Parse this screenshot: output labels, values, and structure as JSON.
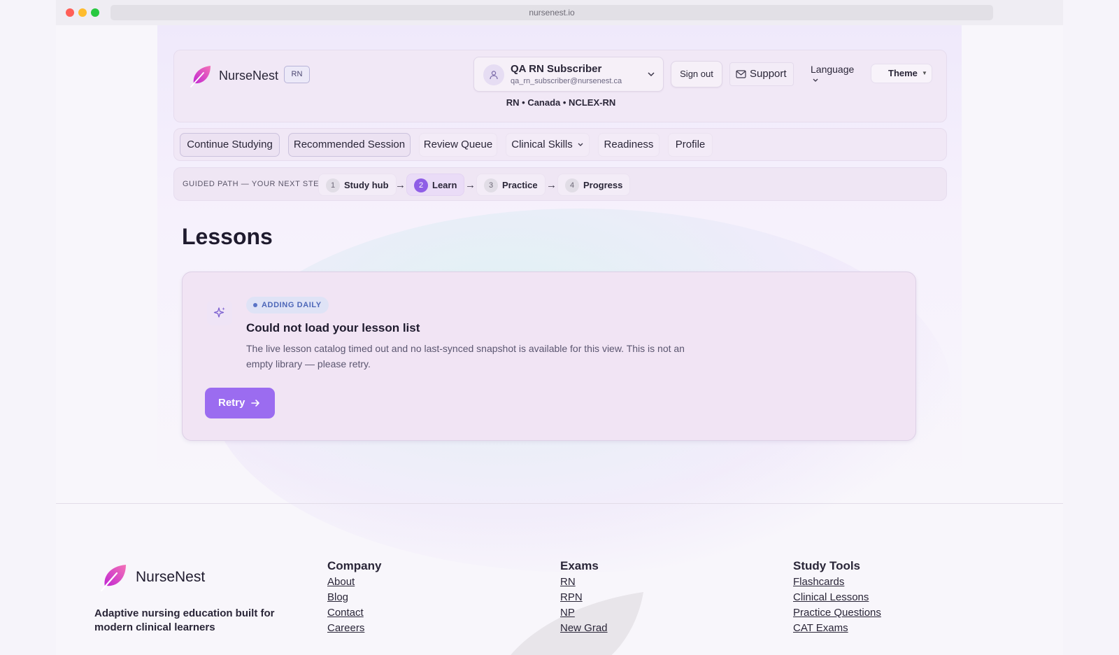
{
  "browser": {
    "url": "nursenest.io"
  },
  "header": {
    "brand": "NurseNest",
    "tier_badge": "RN",
    "user_name": "QA RN Subscriber",
    "user_email": "qa_rn_subscriber@nursenest.ca",
    "sign_out": "Sign out",
    "support": "Support",
    "language": "Language",
    "theme": "Theme",
    "context": "RN • Canada • NCLEX-RN"
  },
  "nav": {
    "items": [
      {
        "label": "Continue Studying"
      },
      {
        "label": "Recommended Session"
      },
      {
        "label": "Review Queue"
      },
      {
        "label": "Clinical Skills"
      },
      {
        "label": "Readiness"
      },
      {
        "label": "Profile"
      }
    ]
  },
  "guided_path": {
    "label": "GUIDED PATH — YOUR NEXT STEP",
    "arrow": "→",
    "steps": [
      {
        "num": "1",
        "label": "Study hub"
      },
      {
        "num": "2",
        "label": "Learn",
        "active": true
      },
      {
        "num": "3",
        "label": "Practice"
      },
      {
        "num": "4",
        "label": "Progress"
      }
    ]
  },
  "lessons": {
    "title": "Lessons",
    "badge": "ADDING DAILY",
    "error_title": "Could not load your lesson list",
    "error_body": "The live lesson catalog timed out and no last-synced snapshot is available for this view. This is not an empty library — please retry.",
    "retry": "Retry"
  },
  "footer": {
    "brand": "NurseNest",
    "tagline": "Adaptive nursing education built for modern clinical learners",
    "columns": [
      {
        "heading": "Company",
        "links": [
          "About",
          "Blog",
          "Contact",
          "Careers"
        ]
      },
      {
        "heading": "Exams",
        "links": [
          "RN",
          "RPN",
          "NP",
          "New Grad"
        ]
      },
      {
        "heading": "Study Tools",
        "links": [
          "Flashcards",
          "Clinical Lessons",
          "Practice Questions",
          "CAT Exams"
        ]
      }
    ]
  },
  "colors": {
    "accent": "#9b6cf0",
    "brand_leaf": "#d946ef",
    "badge_text": "#4d67b8"
  },
  "icons": [
    "leaf-logo-icon",
    "user-icon",
    "chevron-down-icon",
    "mail-icon",
    "sparkle-icon",
    "arrow-right-icon"
  ]
}
